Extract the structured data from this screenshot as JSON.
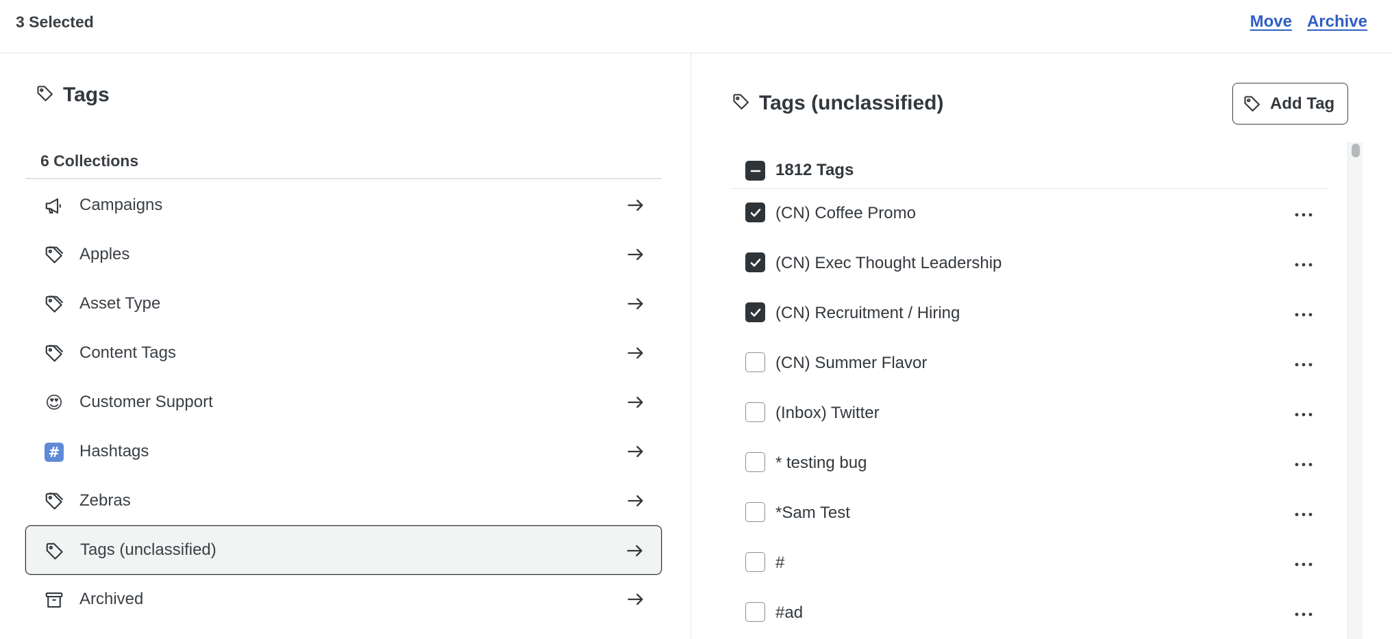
{
  "header": {
    "selected_label": "3 Selected",
    "move_label": "Move",
    "archive_label": "Archive"
  },
  "collections_panel": {
    "title": "Tags",
    "count_label": "6 Collections",
    "items": [
      {
        "label": "Campaigns",
        "icon": "megaphone-icon"
      },
      {
        "label": "Apples",
        "icon": "tag-icon"
      },
      {
        "label": "Asset Type",
        "icon": "tag-icon"
      },
      {
        "label": "Content Tags",
        "icon": "tag-icon"
      },
      {
        "label": "Customer Support",
        "icon": "heart-eyes-emoji-icon",
        "glyph": "😍"
      },
      {
        "label": "Hashtags",
        "icon": "hash-icon",
        "glyph": "#"
      },
      {
        "label": "Zebras",
        "icon": "tag-icon"
      },
      {
        "label": "Tags (unclassified)",
        "icon": "tag-icon",
        "active": true
      },
      {
        "label": "Archived",
        "icon": "archive-box-icon"
      }
    ]
  },
  "tags_panel": {
    "title": "Tags (unclassified)",
    "add_button_label": "Add Tag",
    "count_label": "1812 Tags",
    "tags": [
      {
        "label": "(CN) Coffee Promo",
        "checked": true
      },
      {
        "label": "(CN) Exec Thought Leadership",
        "checked": true
      },
      {
        "label": "(CN) Recruitment / Hiring",
        "checked": true
      },
      {
        "label": "(CN) Summer Flavor",
        "checked": false
      },
      {
        "label": "(Inbox) Twitter",
        "checked": false
      },
      {
        "label": "* testing bug",
        "checked": false
      },
      {
        "label": "*Sam Test",
        "checked": false
      },
      {
        "label": "#",
        "checked": false
      },
      {
        "label": "#ad",
        "checked": false
      }
    ]
  },
  "colors": {
    "link": "#2f5fc4",
    "text": "#33383d",
    "checkbox_fill": "#2f3438",
    "active_row_bg": "#f2f3f3",
    "divider": "#e1e3e5"
  }
}
